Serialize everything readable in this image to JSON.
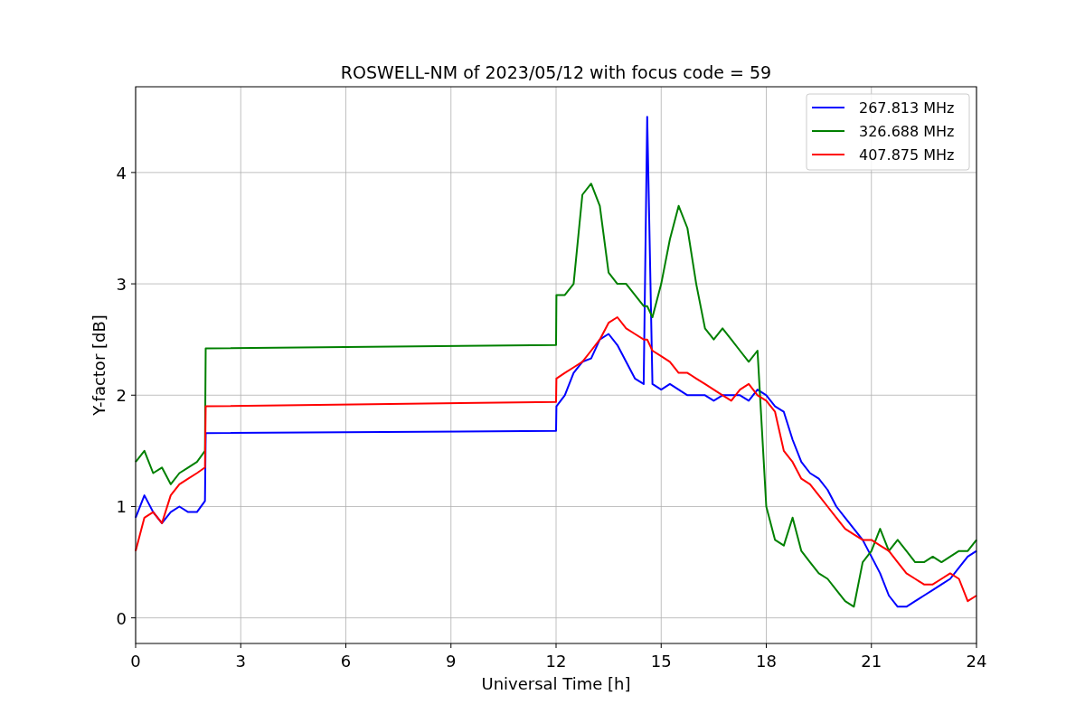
{
  "chart_data": {
    "type": "line",
    "title": "ROSWELL-NM of 2023/05/12 with focus code = 59",
    "xlabel": "Universal Time [h]",
    "ylabel": "Y-factor [dB]",
    "x": [
      0,
      0.25,
      0.5,
      0.75,
      1,
      1.25,
      1.5,
      1.75,
      1.98,
      2.0,
      12.0,
      12.01,
      12.25,
      12.5,
      12.75,
      13,
      13.25,
      13.5,
      13.75,
      14,
      14.25,
      14.5,
      14.6,
      14.75,
      15,
      15.25,
      15.5,
      15.75,
      16,
      16.25,
      16.5,
      16.75,
      17,
      17.25,
      17.5,
      17.75,
      18,
      18.25,
      18.5,
      18.75,
      19,
      19.25,
      19.5,
      19.75,
      20,
      20.25,
      20.5,
      20.75,
      21,
      21.25,
      21.5,
      21.75,
      22,
      22.25,
      22.5,
      22.75,
      23,
      23.25,
      23.5,
      23.75,
      24
    ],
    "series": [
      {
        "name": "267.813 MHz",
        "color": "#0000ff",
        "values": [
          0.9,
          1.1,
          0.95,
          0.85,
          0.95,
          1.0,
          0.95,
          0.95,
          1.05,
          1.66,
          1.68,
          1.9,
          2.0,
          2.2,
          2.3,
          2.33,
          2.5,
          2.55,
          2.45,
          2.3,
          2.15,
          2.1,
          4.5,
          2.1,
          2.05,
          2.1,
          2.05,
          2.0,
          2.0,
          2.0,
          1.95,
          2.0,
          2.0,
          2.0,
          1.95,
          2.05,
          2.0,
          1.9,
          1.85,
          1.6,
          1.4,
          1.3,
          1.25,
          1.15,
          1.0,
          0.9,
          0.8,
          0.7,
          0.55,
          0.4,
          0.2,
          0.1,
          0.1,
          0.15,
          0.2,
          0.25,
          0.3,
          0.35,
          0.45,
          0.55,
          0.6
        ]
      },
      {
        "name": "326.688 MHz",
        "color": "#008000",
        "values": [
          1.4,
          1.5,
          1.3,
          1.35,
          1.2,
          1.3,
          1.35,
          1.4,
          1.5,
          2.42,
          2.45,
          2.9,
          2.9,
          3.0,
          3.8,
          3.9,
          3.7,
          3.1,
          3.0,
          3.0,
          2.9,
          2.8,
          2.8,
          2.7,
          3.0,
          3.4,
          3.7,
          3.5,
          3.0,
          2.6,
          2.5,
          2.6,
          2.5,
          2.4,
          2.3,
          2.4,
          1.0,
          0.7,
          0.65,
          0.9,
          0.6,
          0.5,
          0.4,
          0.35,
          0.25,
          0.15,
          0.1,
          0.5,
          0.6,
          0.8,
          0.6,
          0.7,
          0.6,
          0.5,
          0.5,
          0.55,
          0.5,
          0.55,
          0.6,
          0.6,
          0.7
        ]
      },
      {
        "name": "407.875 MHz",
        "color": "#ff0000",
        "values": [
          0.6,
          0.9,
          0.95,
          0.85,
          1.1,
          1.2,
          1.25,
          1.3,
          1.35,
          1.9,
          1.94,
          2.15,
          2.2,
          2.25,
          2.3,
          2.4,
          2.5,
          2.65,
          2.7,
          2.6,
          2.55,
          2.5,
          2.5,
          2.4,
          2.35,
          2.3,
          2.2,
          2.2,
          2.15,
          2.1,
          2.05,
          2.0,
          1.95,
          2.05,
          2.1,
          2.0,
          1.95,
          1.85,
          1.5,
          1.4,
          1.25,
          1.2,
          1.1,
          1.0,
          0.9,
          0.8,
          0.75,
          0.7,
          0.7,
          0.65,
          0.6,
          0.5,
          0.4,
          0.35,
          0.3,
          0.3,
          0.35,
          0.4,
          0.35,
          0.15,
          0.2
        ]
      }
    ],
    "xlim": [
      0,
      24
    ],
    "ylim": [
      -0.23,
      4.77
    ],
    "xticks": [
      0,
      3,
      6,
      9,
      12,
      15,
      18,
      21,
      24
    ],
    "yticks": [
      0,
      1,
      2,
      3,
      4
    ],
    "grid": true,
    "legend": true
  }
}
